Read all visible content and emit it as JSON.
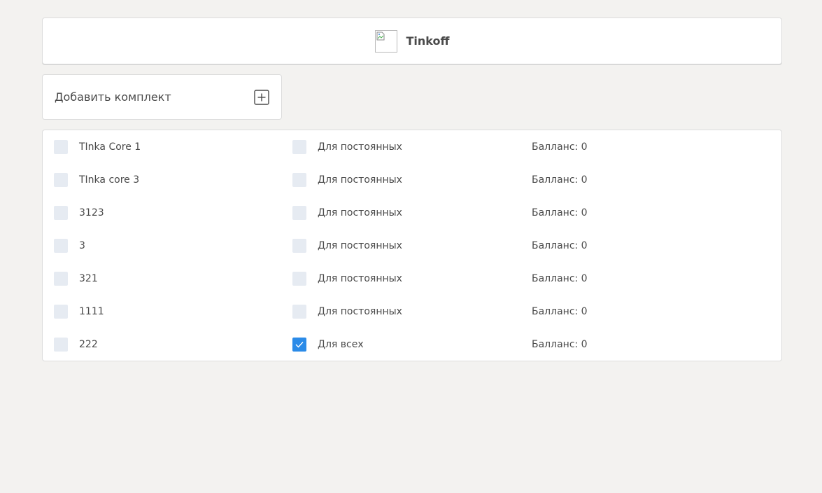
{
  "header": {
    "brand_name": "Tinkoff"
  },
  "add_kit": {
    "label": "Добавить комплект",
    "icon": "plus-square-icon"
  },
  "kits": [
    {
      "name": "TInka Core 1",
      "name_checked": false,
      "type": "Для постоянных",
      "type_checked": false,
      "balance": "Балланс: 0"
    },
    {
      "name": "TInka core 3",
      "name_checked": false,
      "type": "Для постоянных",
      "type_checked": false,
      "balance": "Балланс: 0"
    },
    {
      "name": "3123",
      "name_checked": false,
      "type": "Для постоянных",
      "type_checked": false,
      "balance": "Балланс: 0"
    },
    {
      "name": "3",
      "name_checked": false,
      "type": "Для постоянных",
      "type_checked": false,
      "balance": "Балланс: 0"
    },
    {
      "name": "321",
      "name_checked": false,
      "type": "Для постоянных",
      "type_checked": false,
      "balance": "Балланс: 0"
    },
    {
      "name": "1111",
      "name_checked": false,
      "type": "Для постоянных",
      "type_checked": false,
      "balance": "Балланс: 0"
    },
    {
      "name": "222",
      "name_checked": false,
      "type": "Для всех",
      "type_checked": true,
      "balance": "Балланс: 0"
    }
  ],
  "colors": {
    "page_background": "#f3f2f0",
    "card_background": "#ffffff",
    "checkbox_unchecked": "#e6ebf2",
    "checkbox_checked": "#2b8be8",
    "text": "#4a4a4a"
  }
}
